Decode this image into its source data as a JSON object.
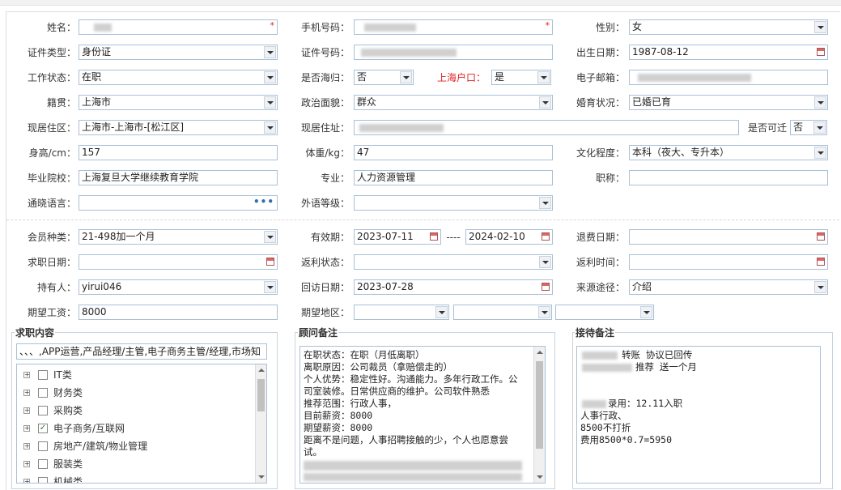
{
  "form": {
    "name": {
      "label": "姓名："
    },
    "mobile": {
      "label": "手机号码："
    },
    "gender": {
      "label": "性别：",
      "value": "女"
    },
    "id_type": {
      "label": "证件类型：",
      "value": "身份证"
    },
    "id_no": {
      "label": "证件号码："
    },
    "birth": {
      "label": "出生日期：",
      "value": "1987-08-12"
    },
    "work_status": {
      "label": "工作状态：",
      "value": "在职"
    },
    "returnee": {
      "label": "是否海归：",
      "value": "否"
    },
    "sh_hukou": {
      "label": "上海户口：",
      "value": "是"
    },
    "email": {
      "label": "电子邮箱："
    },
    "native": {
      "label": "籍贯：",
      "value": "上海市"
    },
    "political": {
      "label": "政治面貌：",
      "value": "群众"
    },
    "marital": {
      "label": "婚育状况：",
      "value": "已婚已育"
    },
    "residence": {
      "label": "现居住区：",
      "value": "上海市-上海市-[松江区]"
    },
    "address": {
      "label": "现居住址："
    },
    "relocate": {
      "label": "是否可迁",
      "value": "否"
    },
    "height": {
      "label": "身高/cm：",
      "value": "157"
    },
    "weight": {
      "label": "体重/kg：",
      "value": "47"
    },
    "education": {
      "label": "文化程度：",
      "value": "本科（夜大、专升本）"
    },
    "school": {
      "label": "毕业院校：",
      "value": "上海复旦大学继续教育学院"
    },
    "major": {
      "label": "专业：",
      "value": "人力资源管理"
    },
    "title": {
      "label": "职称：",
      "value": ""
    },
    "language": {
      "label": "通晓语言：",
      "value": ""
    },
    "foreign_level": {
      "label": "外语等级：",
      "value": ""
    },
    "member_type": {
      "label": "会员种类：",
      "value": "21-498加一个月"
    },
    "valid_period": {
      "label": "有效期：",
      "start": "2023-07-11",
      "sep": "----",
      "end": "2024-02-10"
    },
    "refund_date": {
      "label": "退费日期：",
      "value": ""
    },
    "job_date": {
      "label": "求职日期：",
      "value": ""
    },
    "rebate_status": {
      "label": "返利状态：",
      "value": ""
    },
    "rebate_time": {
      "label": "返利时间：",
      "value": ""
    },
    "holder": {
      "label": "持有人：",
      "value": "yirui046"
    },
    "visit_date": {
      "label": "回访日期：",
      "value": "2023-07-28"
    },
    "source": {
      "label": "来源途径：",
      "value": "介绍"
    },
    "salary": {
      "label": "期望工资：",
      "value": "8000"
    },
    "region": {
      "label": "期望地区：",
      "v1": "",
      "v2": "",
      "v3": ""
    }
  },
  "job_panel": {
    "title": "求职内容",
    "summary": "、、、,APP运营,产品经理/主管,电子商务主管/经理,市场知",
    "items": [
      {
        "label": "IT类",
        "checked": false
      },
      {
        "label": "财务类",
        "checked": false
      },
      {
        "label": "采购类",
        "checked": false
      },
      {
        "label": "电子商务/互联网",
        "checked": true
      },
      {
        "label": "房地产/建筑/物业管理",
        "checked": false
      },
      {
        "label": "服装类",
        "checked": false
      },
      {
        "label": "机械类",
        "checked": false
      }
    ],
    "check_mark": "✓",
    "expander": "+"
  },
  "consultant_panel": {
    "title": "顾问备注",
    "lines": [
      "在职状态：在职（月低离职）",
      "离职原因：公司裁员（拿赔偿走的）",
      "个人优势：稳定性好。沟通能力。多年行政工作。公",
      "司室装修。日常供应商的维护。公司软件熟悉",
      "推荐范围：行政人事，",
      "目前薪资：8000",
      "期望薪资：8000",
      "距离不是问题，人事招聘接触的少，个人也愿意尝",
      "试。"
    ]
  },
  "reception_panel": {
    "title": "接待备注",
    "lines": [
      "转账  协议已回传",
      "推荐 送一个月",
      "",
      "",
      "录用：12.11入职",
      "人事行政、",
      "8500不打折",
      "费用8500*0.7=5950"
    ]
  },
  "colors": {
    "accent_red": "#e02020",
    "border_blue": "#aac0d6"
  }
}
